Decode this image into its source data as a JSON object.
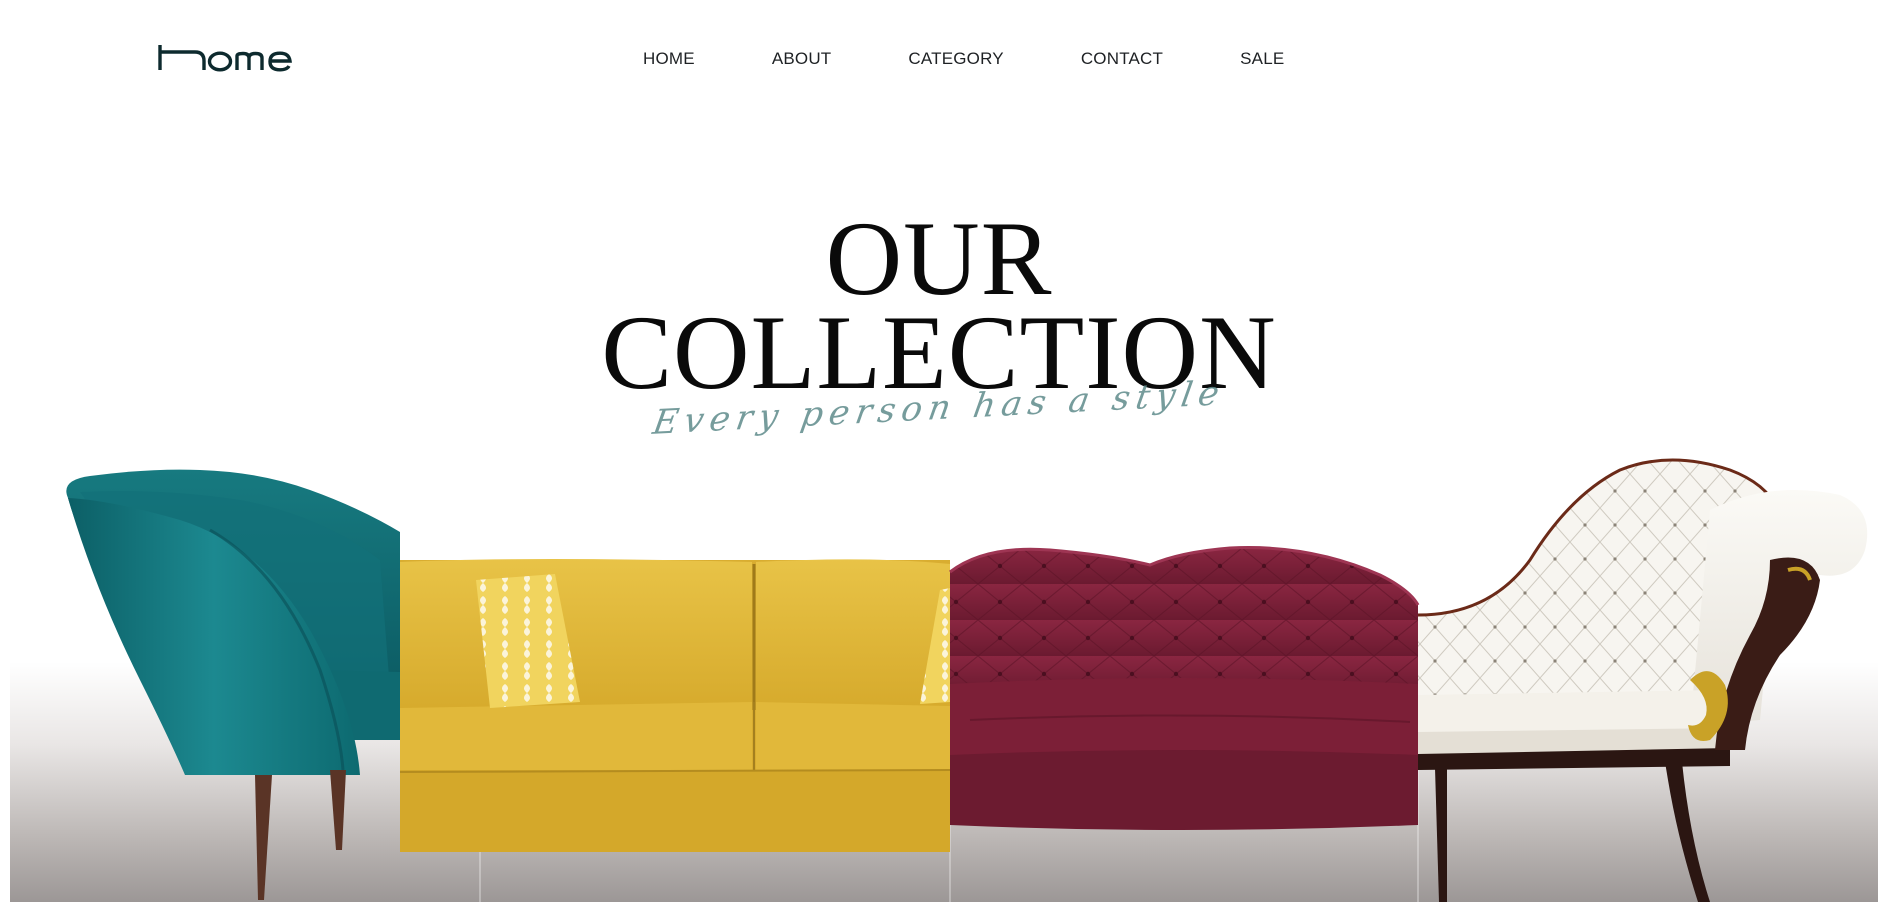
{
  "brand": {
    "logo_text": "home"
  },
  "nav": {
    "items": [
      {
        "label": "HOME"
      },
      {
        "label": "ABOUT"
      },
      {
        "label": "CATEGORY"
      },
      {
        "label": "CONTACT"
      },
      {
        "label": "SALE"
      }
    ]
  },
  "hero": {
    "title_line1": "OUR",
    "title_line2": "COLLECTION",
    "subtitle": "Every person has a style"
  },
  "colors": {
    "teal": "#0f6b72",
    "yellow": "#e2b93b",
    "burgundy": "#7c1f37",
    "ivory": "#f4f1ea",
    "dark_wood": "#2b1612",
    "gold": "#c9a227",
    "subtitle": "#5f8b8b"
  }
}
